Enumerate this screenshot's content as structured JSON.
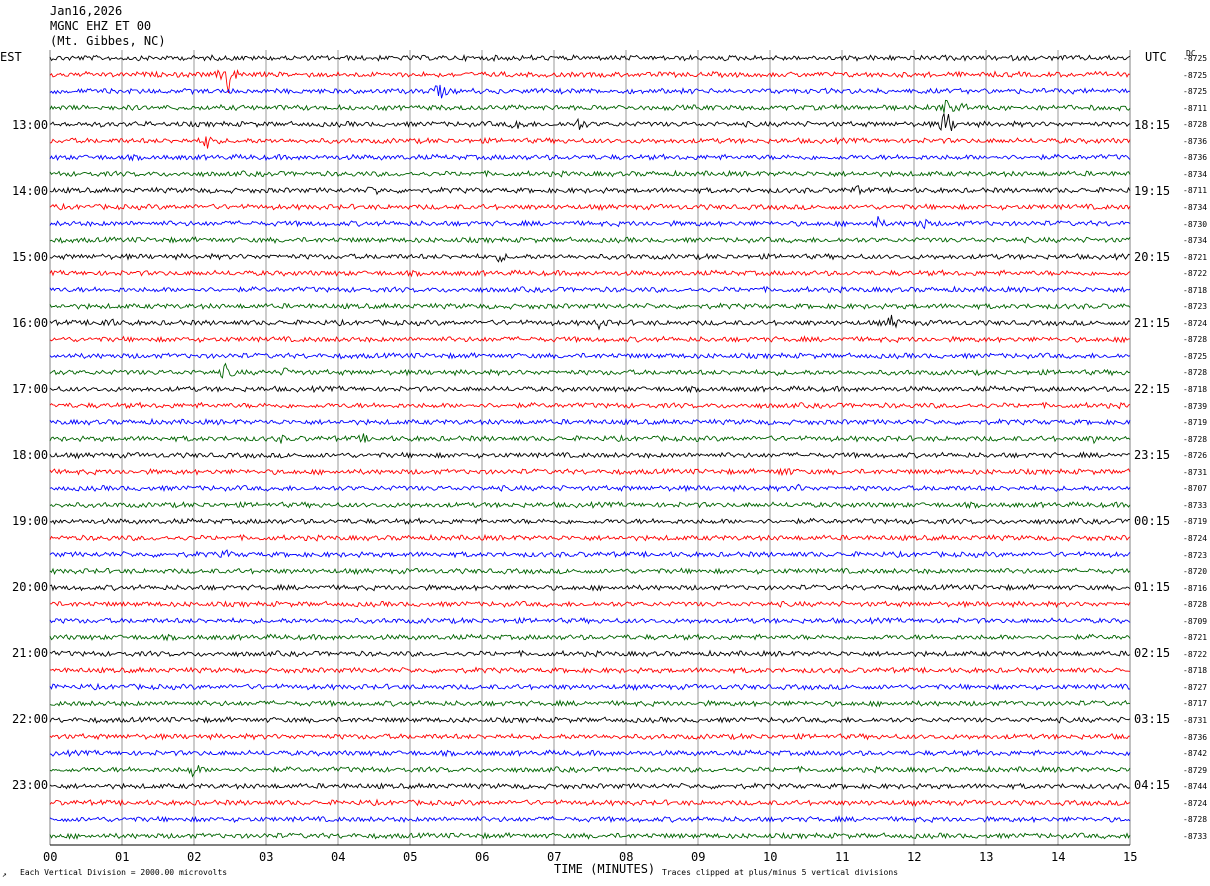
{
  "header": {
    "date": "Jan16,2026",
    "station": "MGNC EHZ ET 00",
    "location": "(Mt. Gibbes, NC)",
    "left_zone": "EST",
    "right_zone": "UTC",
    "dc_label": "DC"
  },
  "footer": {
    "scale_note": "Each Vertical Division = 2000.00 microvolts",
    "clip_note": "Traces clipped at plus/minus 5 vertical divisions",
    "corner_mark": "↗"
  },
  "colors": {
    "trace_cycle": [
      "#000000",
      "#ff0000",
      "#0000ff",
      "#006400"
    ],
    "grid": "#808080"
  },
  "chart_data": {
    "type": "line",
    "title": "MGNC EHZ ET 00 (Mt. Gibbes, NC)",
    "xlabel": "TIME (MINUTES)",
    "ylabel": "",
    "xlim": [
      0,
      15
    ],
    "x_ticks": [
      "00",
      "01",
      "02",
      "03",
      "04",
      "05",
      "06",
      "07",
      "08",
      "09",
      "10",
      "11",
      "12",
      "13",
      "14",
      "15"
    ],
    "rows": 48,
    "left_hour_labels": [
      "13:00",
      "14:00",
      "15:00",
      "16:00",
      "17:00",
      "18:00",
      "19:00",
      "20:00",
      "21:00",
      "22:00",
      "23:00"
    ],
    "right_hour_labels": [
      "18:15",
      "19:15",
      "20:15",
      "21:15",
      "22:15",
      "23:15",
      "00:15",
      "01:15",
      "02:15",
      "03:15",
      "04:15"
    ],
    "dc_offsets": [
      "-8725",
      "-8725",
      "-8725",
      "-8711",
      "-8728",
      "-8736",
      "-8736",
      "-8734",
      "-8711",
      "-8734",
      "-8730",
      "-8734",
      "-8721",
      "-8722",
      "-8718",
      "-8723",
      "-8724",
      "-8728",
      "-8725",
      "-8728",
      "-8718",
      "-8739",
      "-8719",
      "-8728",
      "-8726",
      "-8731",
      "-8707",
      "-8733",
      "-8719",
      "-8724",
      "-8723",
      "-8720",
      "-8716",
      "-8728",
      "-8709",
      "-8721",
      "-8722",
      "-8718",
      "-8727",
      "-8717",
      "-8731",
      "-8736",
      "-8742",
      "-8729",
      "-8744",
      "-8724",
      "-8728",
      "-8733"
    ],
    "events": [
      {
        "row": 1,
        "minute": 2.48,
        "amplitude": 20
      },
      {
        "row": 2,
        "minute": 5.4,
        "amplitude": 10
      },
      {
        "row": 3,
        "minute": 12.45,
        "amplitude": 9
      },
      {
        "row": 3,
        "minute": 12.7,
        "amplitude": 5
      },
      {
        "row": 4,
        "minute": 12.45,
        "amplitude": 16
      },
      {
        "row": 4,
        "minute": 6.5,
        "amplitude": 8
      },
      {
        "row": 4,
        "minute": 7.35,
        "amplitude": 7
      },
      {
        "row": 5,
        "minute": 2.2,
        "amplitude": 9
      },
      {
        "row": 8,
        "minute": 4.5,
        "amplitude": 6
      },
      {
        "row": 8,
        "minute": 11.2,
        "amplitude": 5
      },
      {
        "row": 10,
        "minute": 11.5,
        "amplitude": 6
      },
      {
        "row": 10,
        "minute": 12.1,
        "amplitude": 7
      },
      {
        "row": 12,
        "minute": 6.25,
        "amplitude": 5
      },
      {
        "row": 16,
        "minute": 0.8,
        "amplitude": 7
      },
      {
        "row": 16,
        "minute": 7.65,
        "amplitude": 7
      },
      {
        "row": 16,
        "minute": 11.7,
        "amplitude": 8
      },
      {
        "row": 19,
        "minute": 2.45,
        "amplitude": 9
      },
      {
        "row": 19,
        "minute": 3.3,
        "amplitude": 6
      },
      {
        "row": 23,
        "minute": 3.2,
        "amplitude": 4
      },
      {
        "row": 23,
        "minute": 4.35,
        "amplitude": 4
      },
      {
        "row": 23,
        "minute": 14.5,
        "amplitude": 4
      },
      {
        "row": 25,
        "minute": 10.2,
        "amplitude": 6
      },
      {
        "row": 26,
        "minute": 10.35,
        "amplitude": 5
      },
      {
        "row": 30,
        "minute": 2.45,
        "amplitude": 4
      },
      {
        "row": 43,
        "minute": 2.0,
        "amplitude": 8
      }
    ]
  }
}
